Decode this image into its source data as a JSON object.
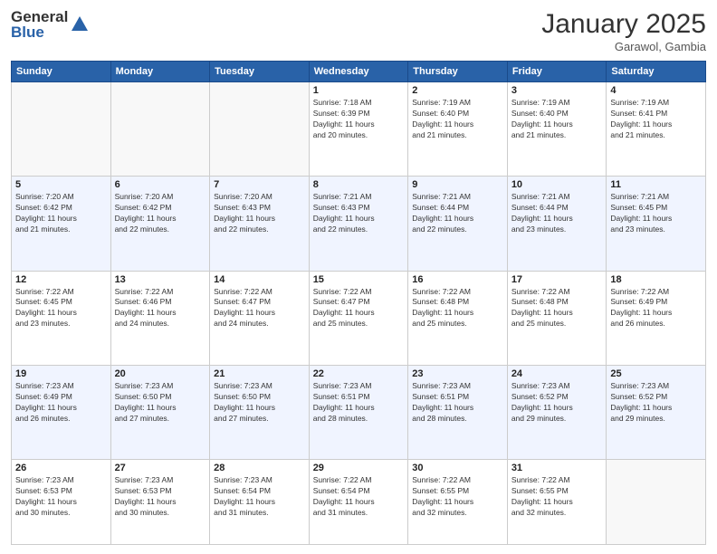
{
  "header": {
    "logo_general": "General",
    "logo_blue": "Blue",
    "month_title": "January 2025",
    "location": "Garawol, Gambia"
  },
  "days_of_week": [
    "Sunday",
    "Monday",
    "Tuesday",
    "Wednesday",
    "Thursday",
    "Friday",
    "Saturday"
  ],
  "weeks": [
    [
      {
        "day": "",
        "info": ""
      },
      {
        "day": "",
        "info": ""
      },
      {
        "day": "",
        "info": ""
      },
      {
        "day": "1",
        "info": "Sunrise: 7:18 AM\nSunset: 6:39 PM\nDaylight: 11 hours\nand 20 minutes."
      },
      {
        "day": "2",
        "info": "Sunrise: 7:19 AM\nSunset: 6:40 PM\nDaylight: 11 hours\nand 21 minutes."
      },
      {
        "day": "3",
        "info": "Sunrise: 7:19 AM\nSunset: 6:40 PM\nDaylight: 11 hours\nand 21 minutes."
      },
      {
        "day": "4",
        "info": "Sunrise: 7:19 AM\nSunset: 6:41 PM\nDaylight: 11 hours\nand 21 minutes."
      }
    ],
    [
      {
        "day": "5",
        "info": "Sunrise: 7:20 AM\nSunset: 6:42 PM\nDaylight: 11 hours\nand 21 minutes."
      },
      {
        "day": "6",
        "info": "Sunrise: 7:20 AM\nSunset: 6:42 PM\nDaylight: 11 hours\nand 22 minutes."
      },
      {
        "day": "7",
        "info": "Sunrise: 7:20 AM\nSunset: 6:43 PM\nDaylight: 11 hours\nand 22 minutes."
      },
      {
        "day": "8",
        "info": "Sunrise: 7:21 AM\nSunset: 6:43 PM\nDaylight: 11 hours\nand 22 minutes."
      },
      {
        "day": "9",
        "info": "Sunrise: 7:21 AM\nSunset: 6:44 PM\nDaylight: 11 hours\nand 22 minutes."
      },
      {
        "day": "10",
        "info": "Sunrise: 7:21 AM\nSunset: 6:44 PM\nDaylight: 11 hours\nand 23 minutes."
      },
      {
        "day": "11",
        "info": "Sunrise: 7:21 AM\nSunset: 6:45 PM\nDaylight: 11 hours\nand 23 minutes."
      }
    ],
    [
      {
        "day": "12",
        "info": "Sunrise: 7:22 AM\nSunset: 6:45 PM\nDaylight: 11 hours\nand 23 minutes."
      },
      {
        "day": "13",
        "info": "Sunrise: 7:22 AM\nSunset: 6:46 PM\nDaylight: 11 hours\nand 24 minutes."
      },
      {
        "day": "14",
        "info": "Sunrise: 7:22 AM\nSunset: 6:47 PM\nDaylight: 11 hours\nand 24 minutes."
      },
      {
        "day": "15",
        "info": "Sunrise: 7:22 AM\nSunset: 6:47 PM\nDaylight: 11 hours\nand 25 minutes."
      },
      {
        "day": "16",
        "info": "Sunrise: 7:22 AM\nSunset: 6:48 PM\nDaylight: 11 hours\nand 25 minutes."
      },
      {
        "day": "17",
        "info": "Sunrise: 7:22 AM\nSunset: 6:48 PM\nDaylight: 11 hours\nand 25 minutes."
      },
      {
        "day": "18",
        "info": "Sunrise: 7:22 AM\nSunset: 6:49 PM\nDaylight: 11 hours\nand 26 minutes."
      }
    ],
    [
      {
        "day": "19",
        "info": "Sunrise: 7:23 AM\nSunset: 6:49 PM\nDaylight: 11 hours\nand 26 minutes."
      },
      {
        "day": "20",
        "info": "Sunrise: 7:23 AM\nSunset: 6:50 PM\nDaylight: 11 hours\nand 27 minutes."
      },
      {
        "day": "21",
        "info": "Sunrise: 7:23 AM\nSunset: 6:50 PM\nDaylight: 11 hours\nand 27 minutes."
      },
      {
        "day": "22",
        "info": "Sunrise: 7:23 AM\nSunset: 6:51 PM\nDaylight: 11 hours\nand 28 minutes."
      },
      {
        "day": "23",
        "info": "Sunrise: 7:23 AM\nSunset: 6:51 PM\nDaylight: 11 hours\nand 28 minutes."
      },
      {
        "day": "24",
        "info": "Sunrise: 7:23 AM\nSunset: 6:52 PM\nDaylight: 11 hours\nand 29 minutes."
      },
      {
        "day": "25",
        "info": "Sunrise: 7:23 AM\nSunset: 6:52 PM\nDaylight: 11 hours\nand 29 minutes."
      }
    ],
    [
      {
        "day": "26",
        "info": "Sunrise: 7:23 AM\nSunset: 6:53 PM\nDaylight: 11 hours\nand 30 minutes."
      },
      {
        "day": "27",
        "info": "Sunrise: 7:23 AM\nSunset: 6:53 PM\nDaylight: 11 hours\nand 30 minutes."
      },
      {
        "day": "28",
        "info": "Sunrise: 7:23 AM\nSunset: 6:54 PM\nDaylight: 11 hours\nand 31 minutes."
      },
      {
        "day": "29",
        "info": "Sunrise: 7:22 AM\nSunset: 6:54 PM\nDaylight: 11 hours\nand 31 minutes."
      },
      {
        "day": "30",
        "info": "Sunrise: 7:22 AM\nSunset: 6:55 PM\nDaylight: 11 hours\nand 32 minutes."
      },
      {
        "day": "31",
        "info": "Sunrise: 7:22 AM\nSunset: 6:55 PM\nDaylight: 11 hours\nand 32 minutes."
      },
      {
        "day": "",
        "info": ""
      }
    ]
  ]
}
